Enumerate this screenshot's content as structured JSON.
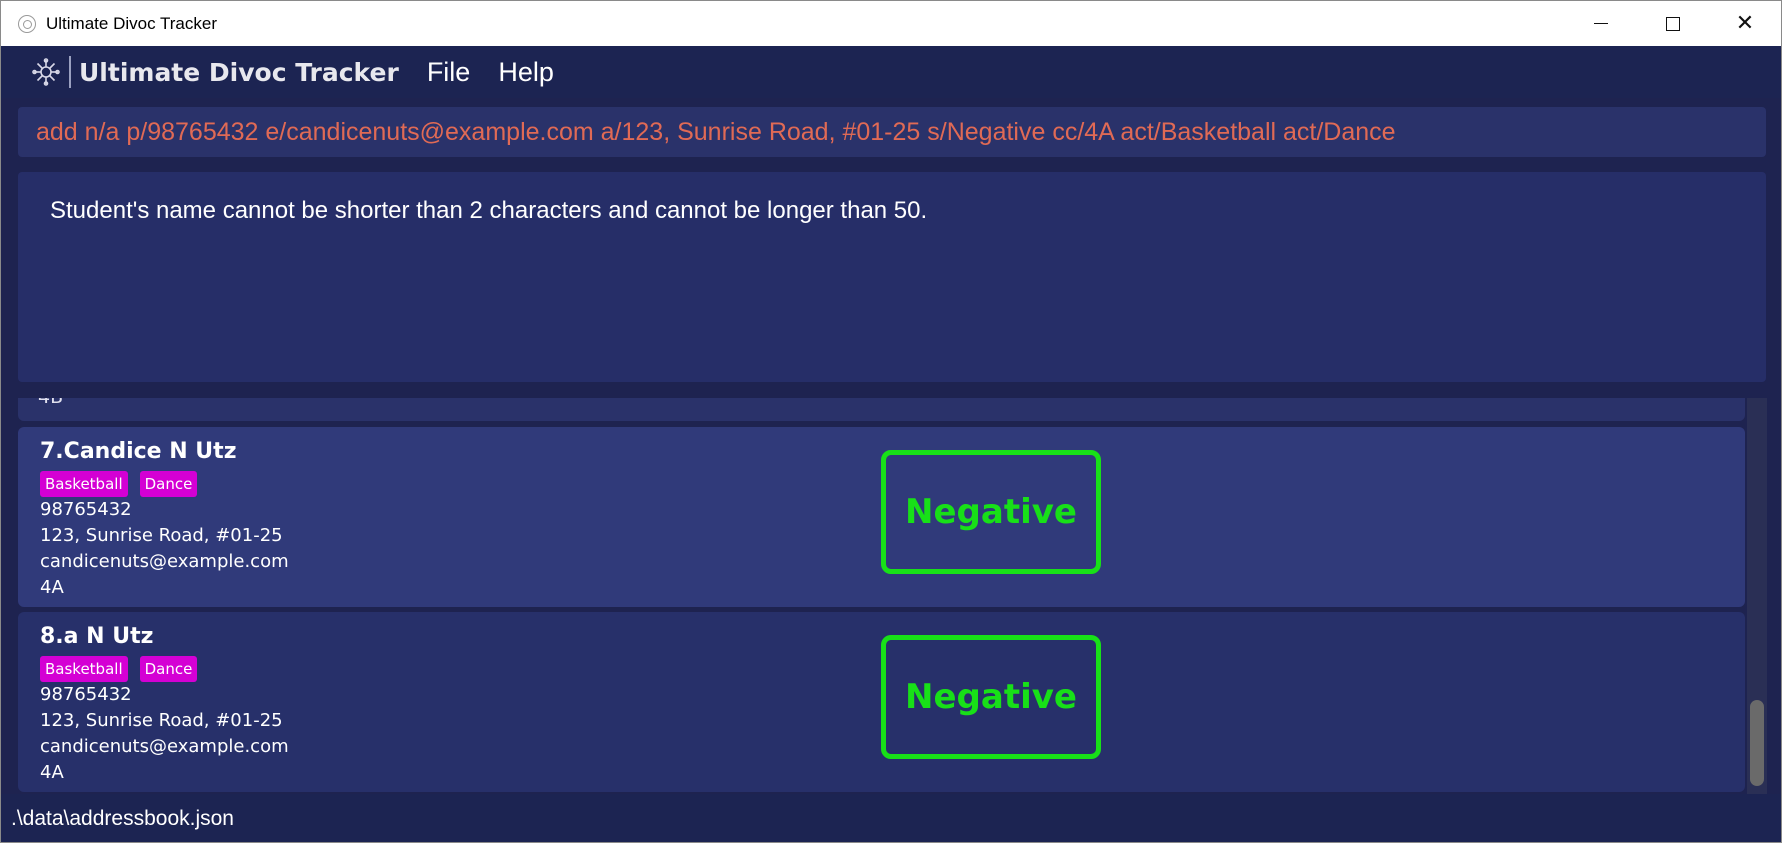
{
  "window": {
    "title": "Ultimate Divoc Tracker",
    "controls": [
      "minimize-icon",
      "maximize-icon",
      "close-icon"
    ]
  },
  "menubar": {
    "app_name": "Ultimate Divoc Tracker",
    "items": [
      {
        "label": "File"
      },
      {
        "label": "Help"
      }
    ]
  },
  "command": {
    "value": "add n/a p/98765432 e/candicenuts@example.com a/123, Sunrise Road, #01-25 s/Negative cc/4A act/Basketball act/Dance"
  },
  "result": {
    "message": "Student's name cannot be shorter than 2 characters and cannot be longer than 50."
  },
  "list": {
    "previous_partial": "4B",
    "students": [
      {
        "index": "7.",
        "name": "Candice N Utz",
        "tags": [
          "Basketball",
          "Dance"
        ],
        "phone": "98765432",
        "address": "123, Sunrise Road, #01-25",
        "email": "candicenuts@example.com",
        "cca": "4A",
        "status": "Negative"
      },
      {
        "index": "8.",
        "name": "a N Utz",
        "tags": [
          "Basketball",
          "Dance"
        ],
        "phone": "98765432",
        "address": "123, Sunrise Road, #01-25",
        "email": "candicenuts@example.com",
        "cca": "4A",
        "status": "Negative"
      }
    ]
  },
  "statusbar": {
    "path": ".\\data\\addressbook.json"
  },
  "colors": {
    "background": "#1e2350",
    "command_text": "#e06a55",
    "tag": "#d400d4",
    "status_negative": "#18e018"
  }
}
